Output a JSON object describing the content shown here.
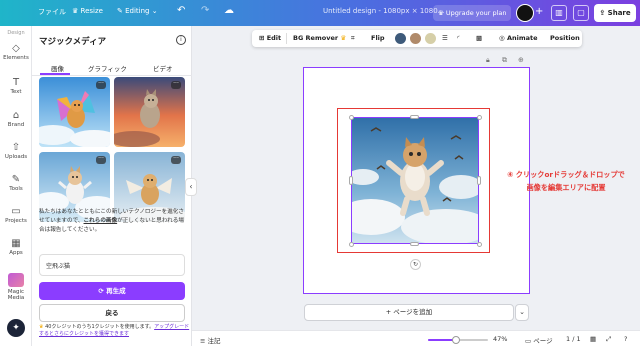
{
  "topbar": {
    "file_label": "ファイル",
    "resize_label": "Resize",
    "editing_label": "Editing",
    "doc_title": "Untitled design - 1080px × 1080...",
    "upgrade_label": "Upgrade your plan",
    "share_label": "Share"
  },
  "rail": {
    "design_label": "Design",
    "items": [
      "Elements",
      "Text",
      "Brand",
      "Uploads",
      "Tools",
      "Projects",
      "Apps",
      "Magic Media"
    ]
  },
  "panel": {
    "title": "マジックメディア",
    "tabs": [
      "画像",
      "グラフィック",
      "ビデオ"
    ],
    "notice": {
      "text_before": "私たちはあなたとともにこの新しいテクノロジーを進化させていますので、",
      "link": "これらの画像",
      "text_after": "が正しくないと思われる場合は報告してください。"
    },
    "prompt": "空飛ぶ猫",
    "regenerate_label": "再生成",
    "back_label": "戻る",
    "credit": {
      "text": "40クレジットのうち1クレジットを使用します。",
      "link": "アップグレードするとさらにクレジットを獲得できます"
    }
  },
  "toolbar": {
    "edit": "Edit",
    "bg_remover": "BG Remover",
    "flip": "Flip",
    "animate": "Animate",
    "position": "Position",
    "swatches": [
      "#3e5a7a",
      "#b08a6a",
      "#d6cfa8"
    ]
  },
  "canvas": {
    "annotation_line1": "④ クリックorドラッグ＆ドロップで",
    "annotation_line2": "画像を編集エリアに配置",
    "add_page_label": "+ ページを追加"
  },
  "bottombar": {
    "notes_label": "注記",
    "zoom": "47%",
    "zoom_fraction": 0.47,
    "pages_label": "ページ",
    "page_count": "1 / 1"
  }
}
